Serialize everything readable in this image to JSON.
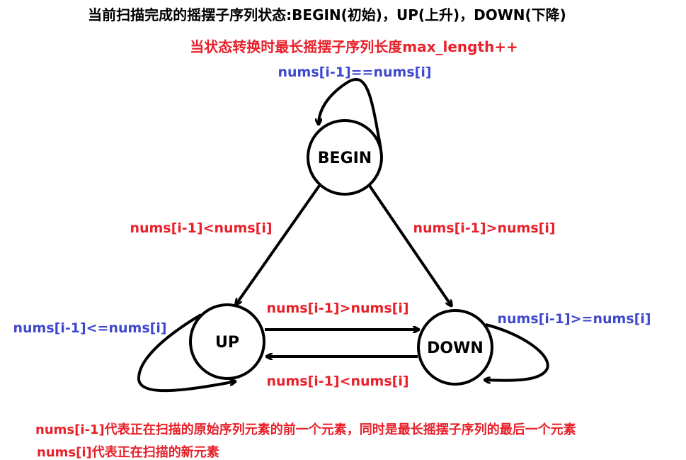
{
  "colors": {
    "black": "#000000",
    "red": "#e8202a",
    "blue": "#3f48cc"
  },
  "header": {
    "title": "当前扫描完成的摇摆子序列状态:BEGIN(初始)，UP(上升)，DOWN(下降)",
    "subtitle": "当状态转换时最长摇摆子序列长度max_length++"
  },
  "nodes": {
    "begin": "BEGIN",
    "up": "UP",
    "down": "DOWN"
  },
  "transitions": {
    "begin_self": "nums[i-1]==nums[i]",
    "begin_to_up": "nums[i-1]<nums[i]",
    "begin_to_down": "nums[i-1]>nums[i]",
    "up_to_down": "nums[i-1]>nums[i]",
    "down_to_up": "nums[i-1]<nums[i]",
    "up_self": "nums[i-1]<=nums[i]",
    "down_self": "nums[i-1]>=nums[i]"
  },
  "notes": {
    "line1": "nums[i-1]代表正在扫描的原始序列元素的前一个元素，同时是最长摇摆子序列的最后一个元素",
    "line2": "nums[i]代表正在扫描的新元素"
  }
}
